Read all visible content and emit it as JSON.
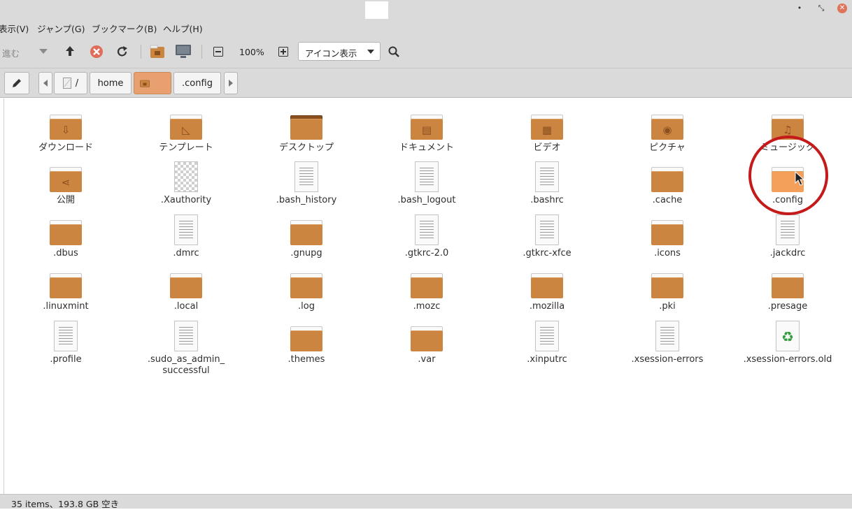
{
  "window": {
    "buttons": {
      "minimize": "•",
      "maximize": "⤡",
      "close": "✕"
    }
  },
  "menubar": {
    "items": [
      "表示(V)",
      "ジャンプ(G)",
      "ブックマーク(B)",
      "ヘルプ(H)"
    ]
  },
  "toolbar": {
    "forward_label": "進む",
    "zoom_level": "100%",
    "view_mode": "アイコン表示"
  },
  "pathbar": {
    "root_label": "/",
    "segments": [
      "home",
      ".config"
    ]
  },
  "files": [
    {
      "name": "ダウンロード",
      "kind": "folder",
      "icon": "download-icon"
    },
    {
      "name": "テンプレート",
      "kind": "folder",
      "icon": "template-icon"
    },
    {
      "name": "デスクトップ",
      "kind": "folder",
      "icon": "desktop-icon"
    },
    {
      "name": "ドキュメント",
      "kind": "folder",
      "icon": "document-icon"
    },
    {
      "name": "ビデオ",
      "kind": "folder",
      "icon": "film-icon"
    },
    {
      "name": "ピクチャ",
      "kind": "folder",
      "icon": "camera-icon"
    },
    {
      "name": "ミュージック",
      "kind": "folder",
      "icon": "music-icon"
    },
    {
      "name": "公開",
      "kind": "folder",
      "icon": "share-icon"
    },
    {
      "name": ".Xauthority",
      "kind": "image",
      "icon": "checker-icon"
    },
    {
      "name": ".bash_history",
      "kind": "text",
      "icon": "text-file-icon"
    },
    {
      "name": ".bash_logout",
      "kind": "text",
      "icon": "text-file-icon"
    },
    {
      "name": ".bashrc",
      "kind": "text",
      "icon": "text-file-icon"
    },
    {
      "name": ".cache",
      "kind": "folder",
      "icon": "folder-icon"
    },
    {
      "name": ".config",
      "kind": "folder",
      "icon": "folder-icon",
      "hover": true
    },
    {
      "name": ".dbus",
      "kind": "folder",
      "icon": "folder-icon"
    },
    {
      "name": ".dmrc",
      "kind": "text",
      "icon": "text-file-icon"
    },
    {
      "name": ".gnupg",
      "kind": "folder",
      "icon": "folder-icon"
    },
    {
      "name": ".gtkrc-2.0",
      "kind": "text",
      "icon": "text-file-icon"
    },
    {
      "name": ".gtkrc-xfce",
      "kind": "text",
      "icon": "text-file-icon"
    },
    {
      "name": ".icons",
      "kind": "folder",
      "icon": "folder-icon"
    },
    {
      "name": ".jackdrc",
      "kind": "text",
      "icon": "text-file-icon"
    },
    {
      "name": ".linuxmint",
      "kind": "folder",
      "icon": "folder-icon"
    },
    {
      "name": ".local",
      "kind": "folder",
      "icon": "folder-icon"
    },
    {
      "name": ".log",
      "kind": "folder",
      "icon": "folder-icon"
    },
    {
      "name": ".mozc",
      "kind": "folder",
      "icon": "folder-icon"
    },
    {
      "name": ".mozilla",
      "kind": "folder",
      "icon": "folder-icon"
    },
    {
      "name": ".pki",
      "kind": "folder",
      "icon": "folder-icon"
    },
    {
      "name": ".presage",
      "kind": "folder",
      "icon": "folder-icon"
    },
    {
      "name": ".profile",
      "kind": "text",
      "icon": "text-file-icon"
    },
    {
      "name": ".sudo_as_admin_\nsuccessful",
      "kind": "text",
      "icon": "text-file-icon"
    },
    {
      "name": ".themes",
      "kind": "folder",
      "icon": "folder-icon"
    },
    {
      "name": ".var",
      "kind": "folder",
      "icon": "folder-icon"
    },
    {
      "name": ".xinputrc",
      "kind": "text",
      "icon": "text-file-icon"
    },
    {
      "name": ".xsession-errors",
      "kind": "text",
      "icon": "text-file-icon"
    },
    {
      "name": ".xsession-errors.old",
      "kind": "recycle",
      "icon": "recycle-icon"
    }
  ],
  "status": {
    "text": "35 items、193.8 GB 空き"
  },
  "colors": {
    "folder": "#cc8540",
    "folder_hover": "#f4a05a",
    "annotation": "#c41a1a",
    "chrome": "#dadada"
  }
}
